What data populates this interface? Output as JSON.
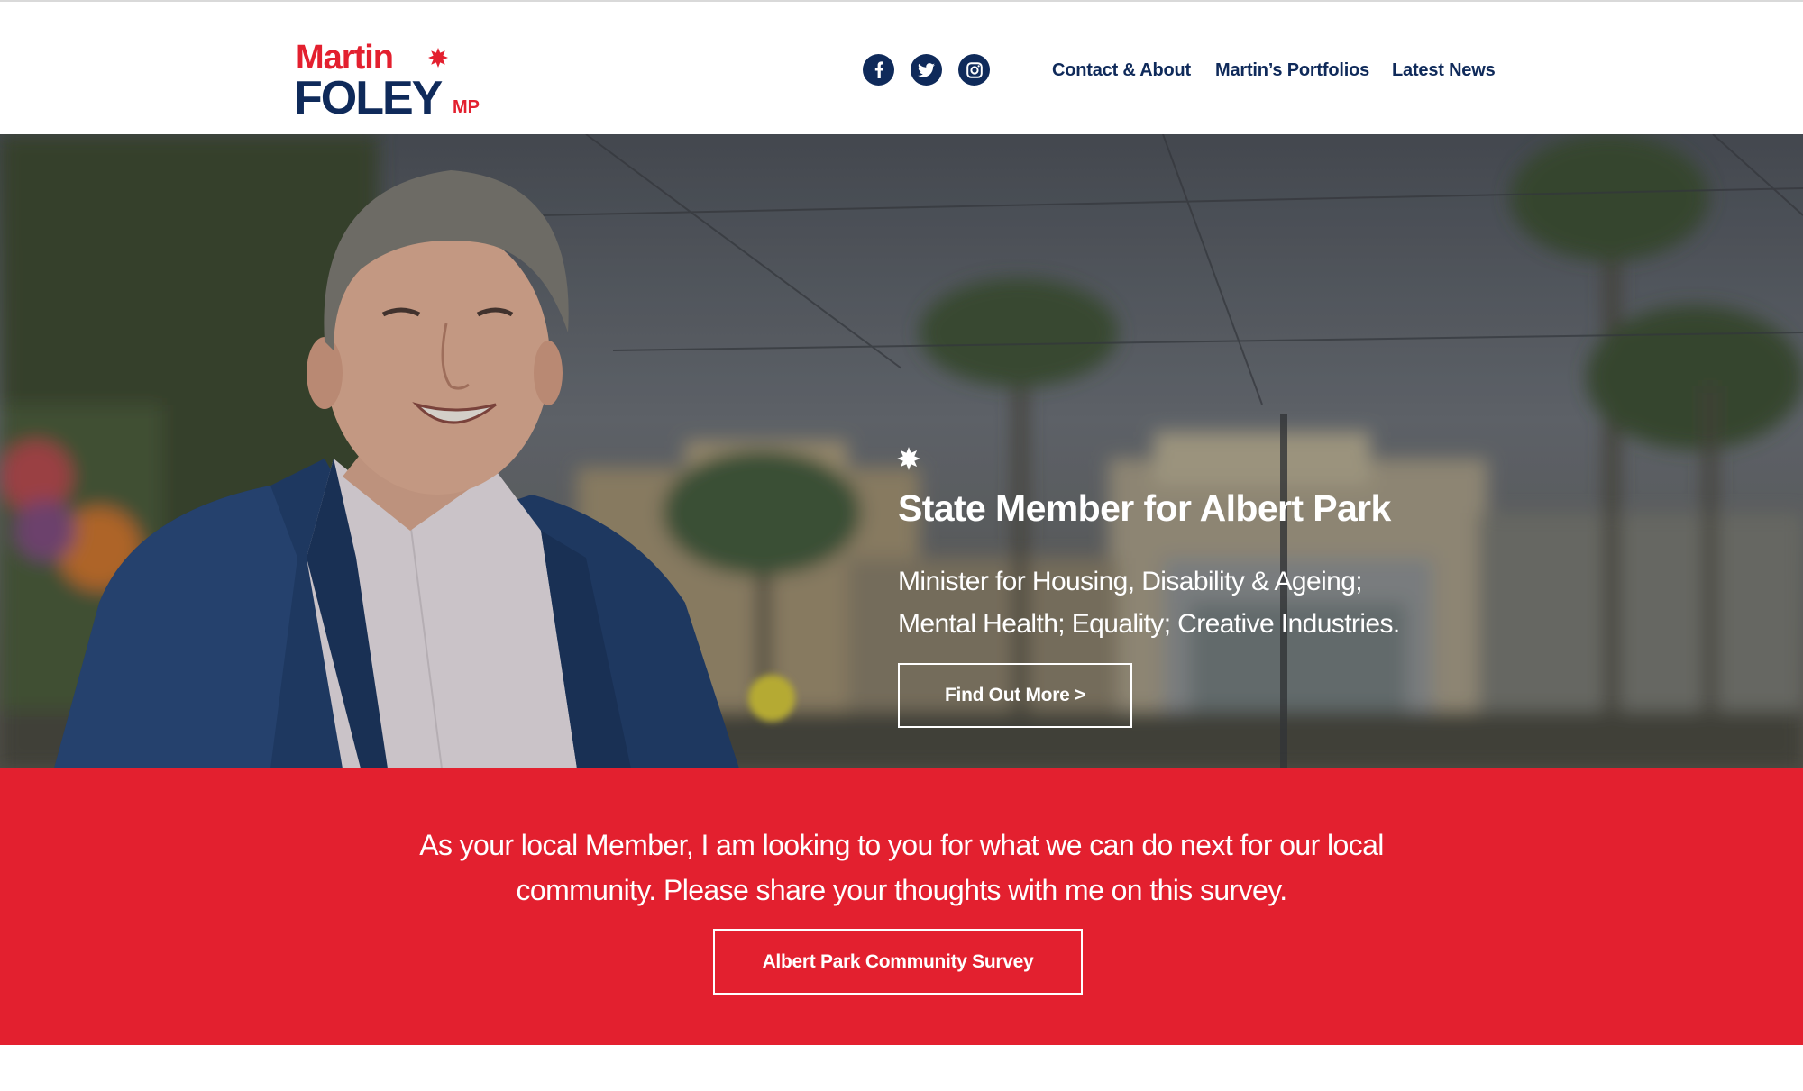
{
  "header": {
    "logo": {
      "first": "Martin",
      "last": "FOLEY",
      "suffix": "MP"
    },
    "social": [
      {
        "name": "facebook",
        "icon": "facebook-icon"
      },
      {
        "name": "twitter",
        "icon": "twitter-icon"
      },
      {
        "name": "instagram",
        "icon": "instagram-icon"
      }
    ],
    "nav": [
      {
        "label": "Contact & About"
      },
      {
        "label": "Martin’s Portfolios"
      },
      {
        "label": "Latest News"
      }
    ]
  },
  "hero": {
    "title": "State Member for Albert Park",
    "subtitle_lines": [
      "Minister for Housing, Disability & Ageing;",
      "Mental Health; Equality; Creative Industries."
    ],
    "button_label": "Find Out More >"
  },
  "band": {
    "text_lines": [
      "As your local Member, I am looking to you for what we can do next for our local",
      "community. Please share your thoughts with me on this survey."
    ],
    "button_label": "Albert Park Community Survey"
  },
  "colors": {
    "navy": "#0f2a5a",
    "red": "#e3202f",
    "white": "#ffffff"
  }
}
